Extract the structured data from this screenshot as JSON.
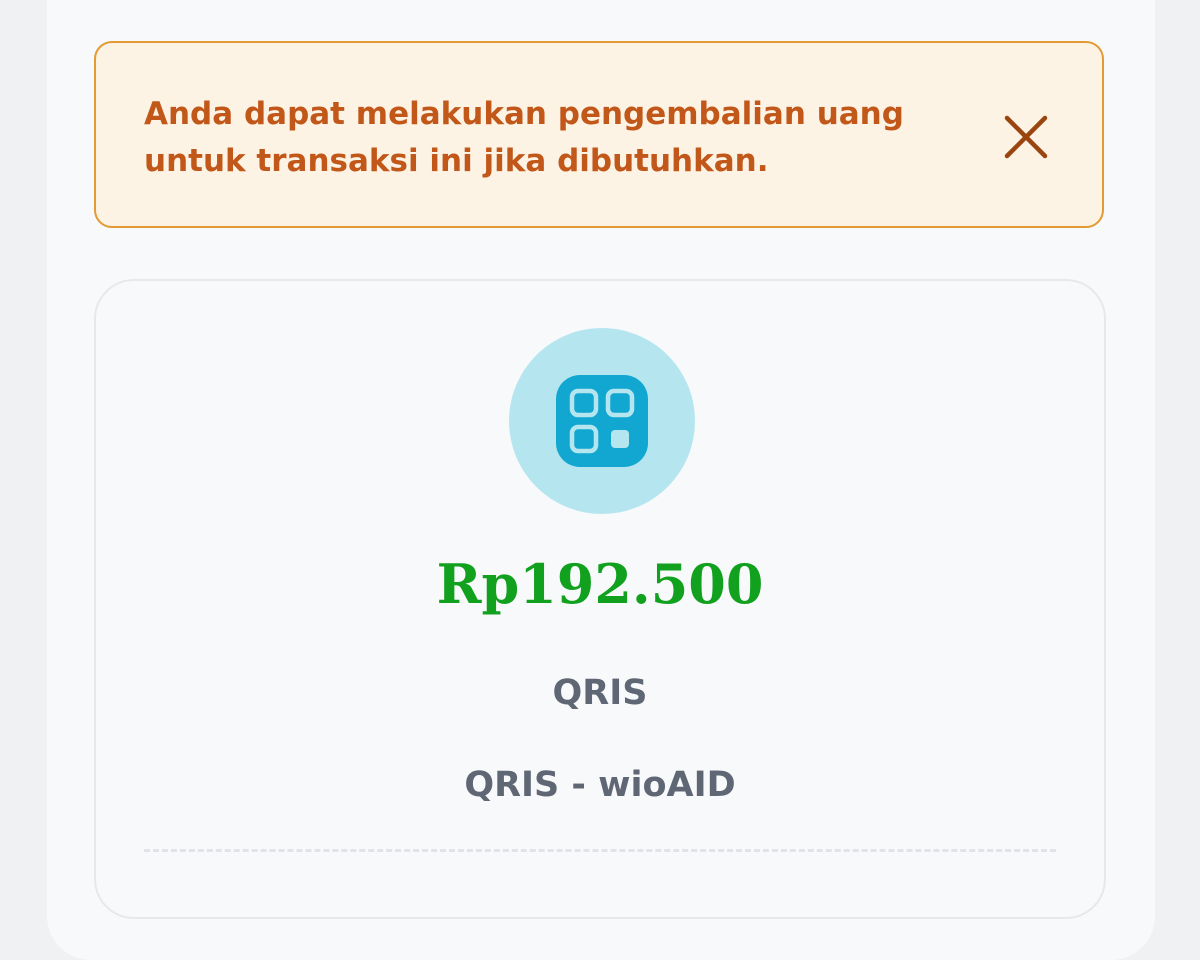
{
  "alert": {
    "message": "Anda dapat melakukan pengembalian uang untuk transaksi ini jika dibutuhkan.",
    "close_icon": "close-icon",
    "text_color": "#c2571a",
    "background": "#fdf3e4",
    "border_color": "#e39a33"
  },
  "payment": {
    "icon": "qris-icon",
    "amount": "Rp192.500",
    "amount_color": "#12a11f",
    "method": "QRIS",
    "merchant": "QRIS - wioAID"
  }
}
